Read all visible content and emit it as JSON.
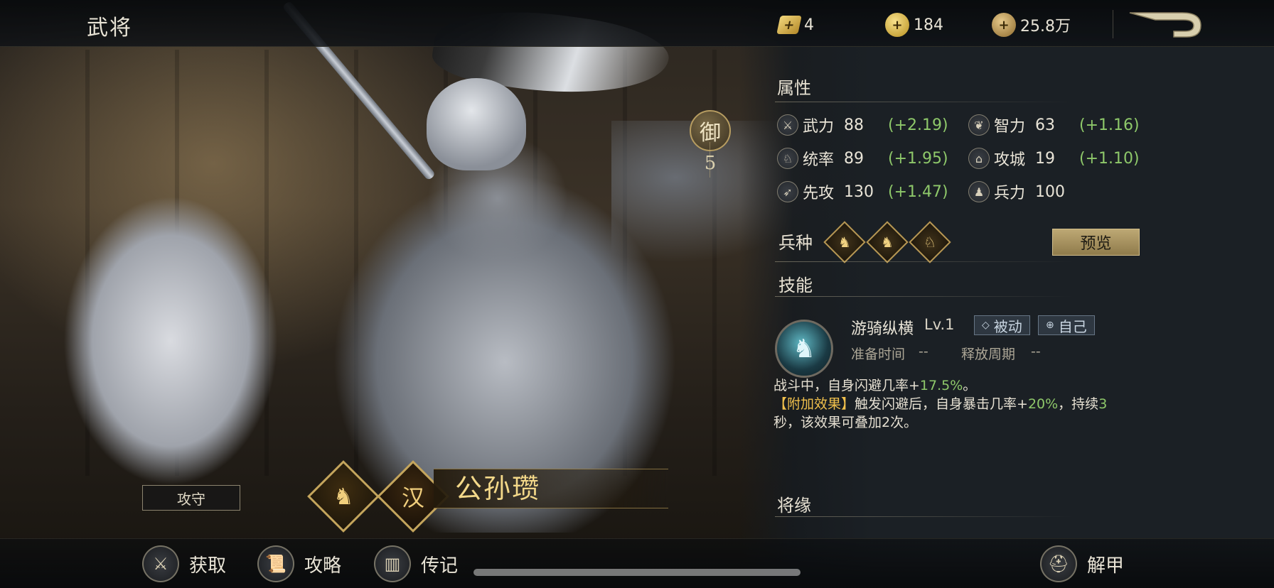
{
  "header": {
    "title": "武将",
    "resources": [
      {
        "icon": "gold-ingot-icon",
        "value": "4"
      },
      {
        "icon": "gold-coin-icon",
        "value": "184"
      },
      {
        "icon": "copper-coins-icon",
        "value": "25.8万"
      }
    ],
    "back_icon": "back-arrow-icon"
  },
  "hero": {
    "name": "公孙瓒",
    "role": "攻守",
    "unit_glyph": "♞",
    "faction_glyph": "汉",
    "defense_badge": "御",
    "defense_level": "5"
  },
  "attributes": {
    "title": "属性",
    "stats": [
      {
        "label": "武力",
        "value": "88",
        "bonus": "(+2.19)",
        "icon": "⚔"
      },
      {
        "label": "智力",
        "value": "63",
        "bonus": "(+1.16)",
        "icon": "❦"
      },
      {
        "label": "统率",
        "value": "89",
        "bonus": "(+1.95)",
        "icon": "♘"
      },
      {
        "label": "攻城",
        "value": "19",
        "bonus": "(+1.10)",
        "icon": "⌂"
      },
      {
        "label": "先攻",
        "value": "130",
        "bonus": "(+1.47)",
        "icon": "➶"
      },
      {
        "label": "兵力",
        "value": "100",
        "bonus": "",
        "icon": "♟"
      }
    ]
  },
  "troops": {
    "title": "兵种",
    "types": [
      "♞",
      "♞",
      "♘"
    ],
    "preview_label": "预览"
  },
  "skill": {
    "title": "技能",
    "name": "游骑纵横",
    "level": "Lv.1",
    "tags": [
      {
        "icon": "◇",
        "label": "被动"
      },
      {
        "icon": "⊕",
        "label": "自己"
      }
    ],
    "prep_label": "准备时间",
    "prep_value": "--",
    "cycle_label": "释放周期",
    "cycle_value": "--",
    "desc": {
      "line1_pre": "战斗中，自身闪避几率+",
      "line1_hl": "17.5%",
      "line1_post": "。",
      "extra_tag": "【附加效果】",
      "extra_pre": "触发闪避后，自身暴击几率+",
      "extra_hl1": "20%",
      "extra_mid": "，持续",
      "extra_hl2": "3",
      "extra_post": "秒，该效果可叠加2次。"
    }
  },
  "bond": {
    "title": "将缘"
  },
  "bottom_nav": {
    "items": [
      {
        "label": "获取",
        "icon": "⚔"
      },
      {
        "label": "攻略",
        "icon": "📜"
      },
      {
        "label": "传记",
        "icon": "▥"
      }
    ],
    "unequip": {
      "label": "解甲",
      "icon": "⛑"
    }
  }
}
